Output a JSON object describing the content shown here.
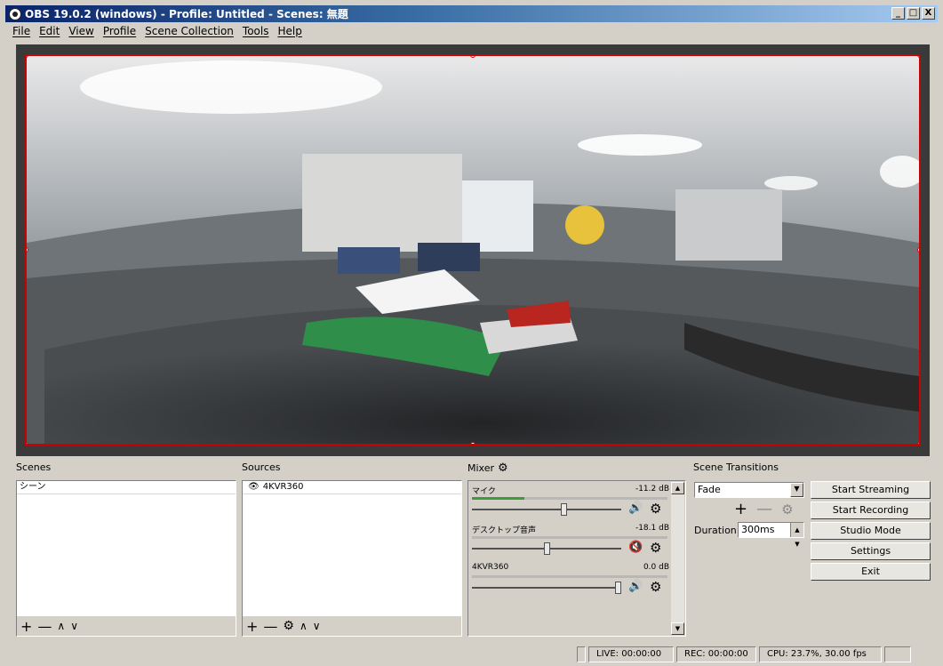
{
  "window": {
    "title": "OBS 19.0.2 (windows) - Profile: Untitled - Scenes: 無題",
    "controls": [
      "_",
      "□",
      "X"
    ]
  },
  "menu": [
    "File",
    "Edit",
    "View",
    "Profile",
    "Scene Collection",
    "Tools",
    "Help"
  ],
  "docks": {
    "scenes": {
      "title": "Scenes",
      "items": [
        "シーン"
      ]
    },
    "sources": {
      "title": "Sources",
      "items": [
        "4KVR360"
      ]
    },
    "mixer": {
      "title": "Mixer",
      "tracks": [
        {
          "name": "マイク",
          "db": "-11.2 dB",
          "level": 0.27,
          "volume": 0.62,
          "muted": false
        },
        {
          "name": "デスクトップ音声",
          "db": "-18.1 dB",
          "level": 0.0,
          "volume": 0.5,
          "muted": true
        },
        {
          "name": "4KVR360",
          "db": "0.0 dB",
          "level": 0.0,
          "volume": 1.0,
          "muted": false
        }
      ]
    },
    "transitions": {
      "title": "Scene Transitions",
      "selected": "Fade",
      "duration_label": "Duration",
      "duration_value": "300ms"
    }
  },
  "controls": {
    "start_streaming": "Start Streaming",
    "start_recording": "Start Recording",
    "studio_mode": "Studio Mode",
    "settings": "Settings",
    "exit": "Exit"
  },
  "status": {
    "live": "LIVE: 00:00:00",
    "rec": "REC: 00:00:00",
    "cpu": "CPU: 23.7%, 30.00 fps"
  },
  "colors": {
    "accent_red": "#cc0000",
    "meter_green": "#3a9c3a",
    "mute_red": "#dd2222"
  }
}
